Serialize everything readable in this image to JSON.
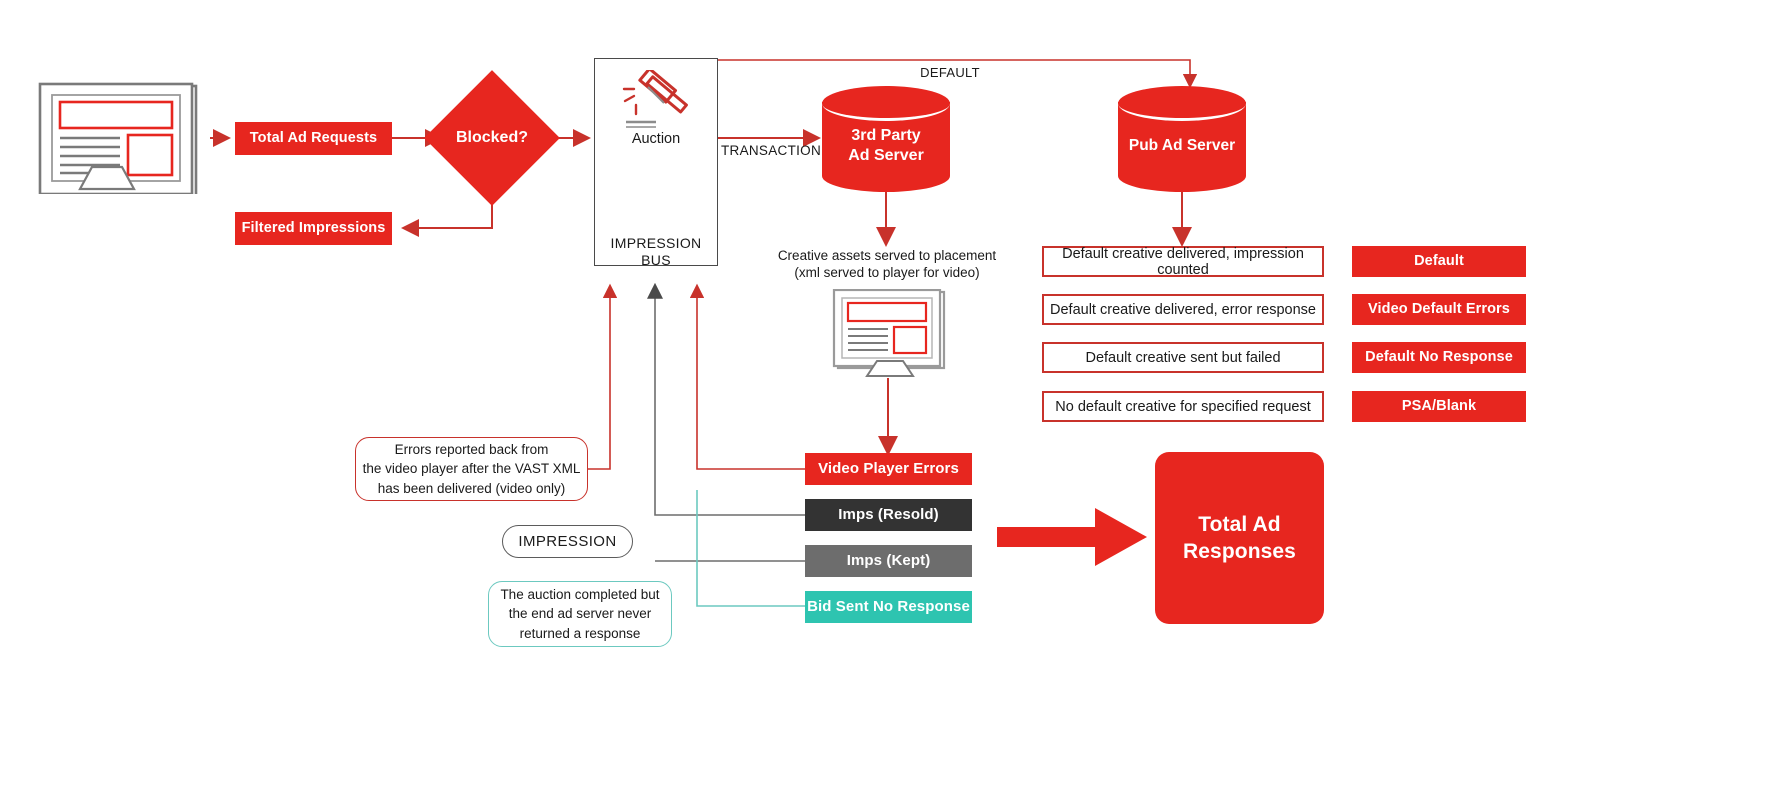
{
  "diagram": {
    "title": "Ad Request to Total Ad Responses Flow"
  },
  "nodes": {
    "total_ad_requests": "Total Ad Requests",
    "blocked": "Blocked?",
    "filtered_impressions": "Filtered Impressions",
    "auction": "Auction",
    "impression_bus": "IMPRESSION BUS",
    "third_party_ad_server": "3rd Party\nAd Server",
    "third_party_ad_server_line1": "3rd Party",
    "third_party_ad_server_line2": "Ad Server",
    "pub_ad_server": "Pub Ad Server",
    "total_ad_responses_line1": "Total Ad",
    "total_ad_responses_line2": "Responses"
  },
  "edge_labels": {
    "transaction": "TRANSACTION",
    "default": "DEFAULT",
    "impression": "IMPRESSION"
  },
  "annotations": {
    "creative_assets_line1": "Creative assets served to placement",
    "creative_assets_line2": "(xml served to player for video)",
    "video_errors_line1": "Errors reported back from",
    "video_errors_line2": "the video player after the VAST XML",
    "video_errors_line3": "has been delivered (video only)",
    "no_response_line1": "The auction completed but",
    "no_response_line2": "the end ad server never",
    "no_response_line3": "returned a response"
  },
  "outcome_boxes": [
    {
      "label": "Default creative delivered, impression counted"
    },
    {
      "label": "Default creative delivered, error response"
    },
    {
      "label": "Default creative sent but failed"
    },
    {
      "label": "No default creative for specified request"
    }
  ],
  "legend": [
    {
      "label": "Default",
      "color": "#E7261F"
    },
    {
      "label": "Video Default Errors",
      "color": "#E7261F"
    },
    {
      "label": "Default No Response",
      "color": "#E7261F"
    },
    {
      "label": "PSA/Blank",
      "color": "#E7261F"
    }
  ],
  "result_bars": [
    {
      "label": "Video Player Errors",
      "color": "#E7261F",
      "style": "red"
    },
    {
      "label": "Imps (Resold)",
      "color": "#333333",
      "style": "dark"
    },
    {
      "label": "Imps (Kept)",
      "color": "#6d6d6d",
      "style": "gray"
    },
    {
      "label": "Bid Sent No Response",
      "color": "#2ec4b0",
      "style": "teal"
    }
  ],
  "colors": {
    "brand_red": "#E7261F",
    "outline_red": "#C8322B",
    "dark": "#333333",
    "gray": "#6d6d6d",
    "teal": "#2ec4b0",
    "teal_border": "#6cc9c0",
    "line_gray": "#7a7a7a",
    "text": "#1a1a1a"
  },
  "icons": {
    "publisher_monitor": "monitor-icon",
    "placement_monitor": "monitor-icon",
    "gavel": "gavel-icon"
  }
}
